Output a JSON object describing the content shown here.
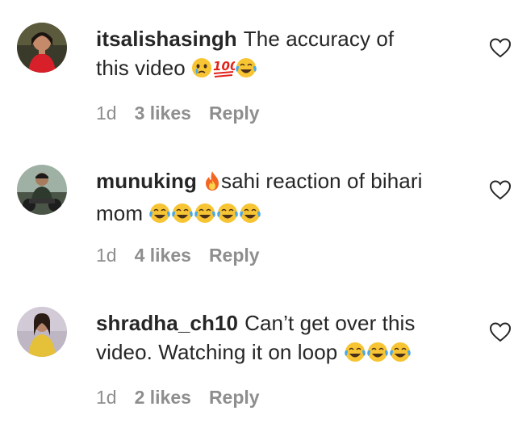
{
  "comments": [
    {
      "username": "itsalishasingh",
      "text_line1": "The accuracy of",
      "text_line2": "this video",
      "emoji_after": [
        "face-holding-back-tears",
        "hundred-points",
        "face-with-tears-of-joy"
      ],
      "time": "1d",
      "likes": "3 likes",
      "reply": "Reply"
    },
    {
      "username": "munuking",
      "emoji_before": [
        "fire"
      ],
      "text_line1": "sahi reaction of bihari",
      "text_line2": "mom",
      "emoji_after": [
        "face-with-tears-of-joy",
        "face-with-tears-of-joy",
        "face-with-tears-of-joy",
        "face-with-tears-of-joy",
        "face-with-tears-of-joy"
      ],
      "time": "1d",
      "likes": "4 likes",
      "reply": "Reply"
    },
    {
      "username": "shradha_ch10",
      "text_line1": "Can’t get over this",
      "text_line2": "video. Watching it on loop",
      "emoji_after": [
        "face-with-tears-of-joy",
        "face-with-tears-of-joy",
        "face-with-tears-of-joy"
      ],
      "time": "1d",
      "likes": "2 likes",
      "reply": "Reply"
    }
  ],
  "icons": {
    "like": "heart-outline-icon"
  },
  "colors": {
    "primary_text": "#262626",
    "secondary_text": "#8e8e8e",
    "emoji_yellow": "#f7c533",
    "emoji_tear": "#4aa8e8",
    "hundred_red": "#e2231a",
    "fire_orange": "#f26522"
  }
}
